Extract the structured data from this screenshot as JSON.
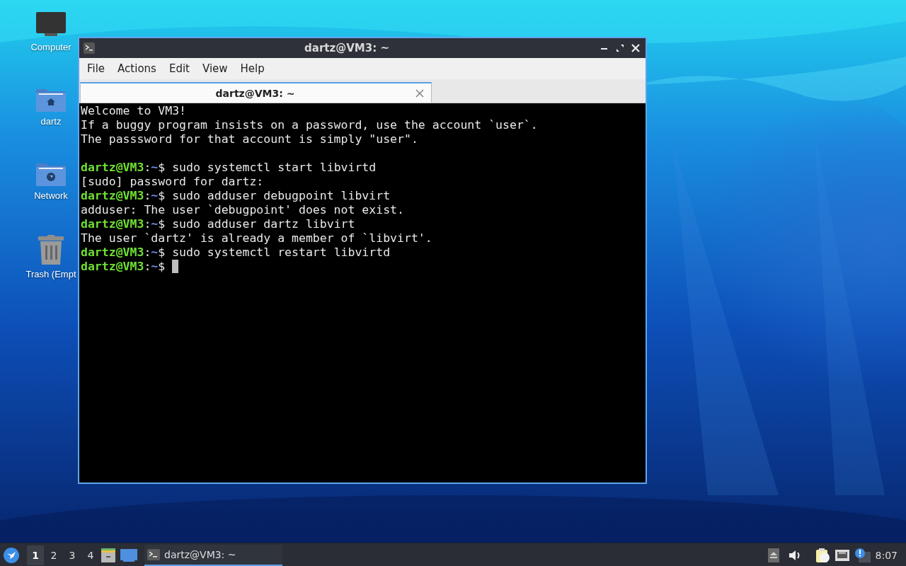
{
  "desktop_icons": [
    {
      "kind": "computer",
      "label": "Computer"
    },
    {
      "kind": "home",
      "label": "dartz"
    },
    {
      "kind": "network",
      "label": "Network"
    },
    {
      "kind": "trash",
      "label": "Trash (Empt"
    }
  ],
  "window": {
    "title": "dartz@VM3: ~",
    "active": true
  },
  "menu": [
    "File",
    "Actions",
    "Edit",
    "View",
    "Help"
  ],
  "tabs": [
    {
      "label": "dartz@VM3: ~",
      "selected": true
    }
  ],
  "terminal": {
    "lines": [
      {
        "kind": "output",
        "text": "Welcome to VM3!"
      },
      {
        "kind": "output",
        "text": "If a buggy program insists on a password, use the account `user`."
      },
      {
        "kind": "output",
        "text": "The passsword for that account is simply \"user\"."
      },
      {
        "kind": "blank"
      },
      {
        "kind": "prompt",
        "user": "dartz@VM3",
        "sep": ":",
        "path": "~",
        "symbol": "$",
        "command": "sudo systemctl start libvirtd",
        "cursor": false
      },
      {
        "kind": "output",
        "text": "[sudo] password for dartz:"
      },
      {
        "kind": "prompt",
        "user": "dartz@VM3",
        "sep": ":",
        "path": "~",
        "symbol": "$",
        "command": "sudo adduser debugpoint libvirt",
        "cursor": false
      },
      {
        "kind": "output",
        "text": "adduser: The user `debugpoint' does not exist."
      },
      {
        "kind": "prompt",
        "user": "dartz@VM3",
        "sep": ":",
        "path": "~",
        "symbol": "$",
        "command": "sudo adduser dartz libvirt",
        "cursor": false
      },
      {
        "kind": "output",
        "text": "The user `dartz' is already a member of `libvirt'."
      },
      {
        "kind": "prompt",
        "user": "dartz@VM3",
        "sep": ":",
        "path": "~",
        "symbol": "$",
        "command": "sudo systemctl restart libvirtd",
        "cursor": false
      },
      {
        "kind": "prompt",
        "user": "dartz@VM3",
        "sep": ":",
        "path": "~",
        "symbol": "$",
        "cursor": true
      }
    ]
  },
  "taskbar": {
    "workspaces": [
      {
        "label": "1",
        "selected": true
      },
      {
        "label": "2",
        "selected": false
      },
      {
        "label": "3",
        "selected": false
      },
      {
        "label": "4",
        "selected": false
      }
    ],
    "tasks": [
      {
        "label": "dartz@VM3: ~",
        "selected": true
      }
    ],
    "clock": "8:07"
  }
}
